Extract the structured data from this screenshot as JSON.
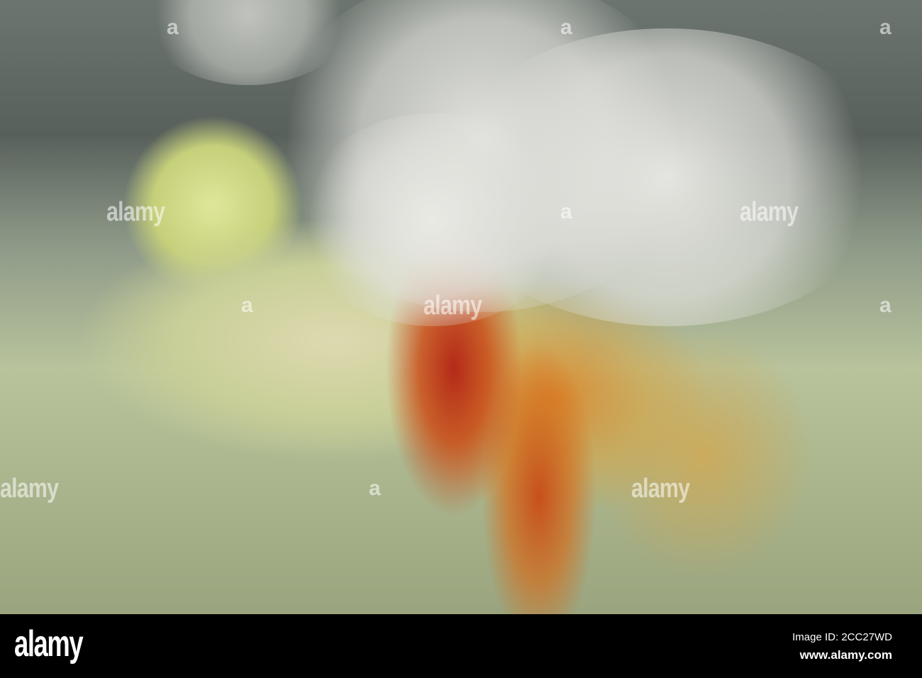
{
  "watermark": {
    "brand": "alamy",
    "short": "a"
  },
  "banner": {
    "logo": "alamy",
    "image_id": "Image ID: 2CC27WD",
    "url": "www.alamy.com"
  }
}
